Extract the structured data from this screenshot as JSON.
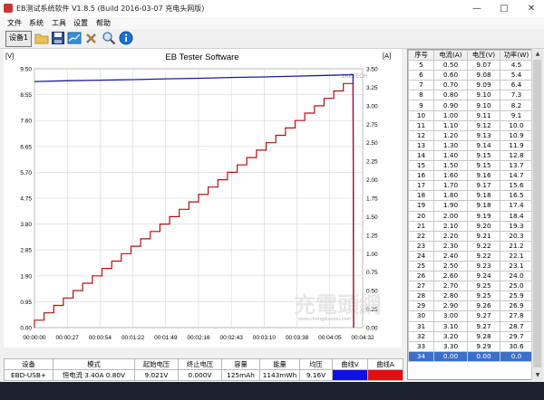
{
  "window": {
    "title": "EB测试系统软件 V1.8.5 (Build 2016-03-07 充电头网版)",
    "minimize": "—",
    "maximize": "□",
    "close": "✕"
  },
  "menu": [
    "文件",
    "系统",
    "工具",
    "设置",
    "帮助"
  ],
  "toolbar": {
    "device_button": "设备1",
    "icons": [
      "folder-icon",
      "save-icon",
      "chart-icon",
      "tools-icon",
      "search-icon",
      "info-icon"
    ]
  },
  "chart": {
    "title": "EB Tester Software",
    "left_unit": "[V]",
    "right_unit": "[A]",
    "brand_mark": "ZKETECH",
    "watermark": "充電頭網",
    "watermark_url": "www.chongdiantou.com",
    "voltage_color": "#1a1aa6",
    "current_color": "#b01010"
  },
  "chart_data": {
    "type": "line",
    "title": "EB Tester Software",
    "ylabel": "[V]",
    "y2label": "[A]",
    "xlim": [
      "00:00:00",
      "00:04:32"
    ],
    "x_tick_labels": [
      "00:00:00",
      "00:00:27",
      "00:00:54",
      "00:01:22",
      "00:01:49",
      "00:02:16",
      "00:02:43",
      "00:03:10",
      "00:03:38",
      "00:04:05",
      "00:04:32"
    ],
    "ylim": [
      0,
      9.5
    ],
    "y_tick_labels": [
      "0.00",
      "0.95",
      "1.90",
      "2.85",
      "3.80",
      "4.75",
      "5.70",
      "6.65",
      "7.60",
      "8.55",
      "9.50"
    ],
    "y2lim": [
      0,
      3.5
    ],
    "y2_tick_labels": [
      "0.00",
      "0.25",
      "0.50",
      "0.75",
      "1.00",
      "1.25",
      "1.50",
      "1.75",
      "2.00",
      "2.25",
      "2.50",
      "2.75",
      "3.00",
      "3.25",
      "3.50"
    ],
    "grid": true,
    "series": [
      {
        "axis": "left",
        "color": "#1a1aa6",
        "x_sec": [
          0,
          27,
          54,
          82,
          109,
          136,
          163,
          190,
          218,
          245,
          262,
          264,
          264.5
        ],
        "values": [
          9.03,
          9.06,
          9.08,
          9.1,
          9.13,
          9.15,
          9.18,
          9.2,
          9.23,
          9.26,
          9.28,
          9.29,
          0.0
        ]
      },
      {
        "axis": "right",
        "color": "#b01010",
        "x_sec": [
          0,
          264,
          264.5
        ],
        "values": [
          0.1,
          3.3,
          0.0
        ],
        "step_a": 0.1,
        "step_count": 33
      }
    ]
  },
  "table": {
    "headers": [
      "序号",
      "电流(A)",
      "电压(V)",
      "功率(W)"
    ],
    "rows": [
      [
        "5",
        "0.50",
        "9.07",
        "4.5"
      ],
      [
        "6",
        "0.60",
        "9.08",
        "5.4"
      ],
      [
        "7",
        "0.70",
        "9.09",
        "6.4"
      ],
      [
        "8",
        "0.80",
        "9.10",
        "7.3"
      ],
      [
        "9",
        "0.90",
        "9.10",
        "8.2"
      ],
      [
        "10",
        "1.00",
        "9.11",
        "9.1"
      ],
      [
        "11",
        "1.10",
        "9.12",
        "10.0"
      ],
      [
        "12",
        "1.20",
        "9.13",
        "10.9"
      ],
      [
        "13",
        "1.30",
        "9.14",
        "11.9"
      ],
      [
        "14",
        "1.40",
        "9.15",
        "12.8"
      ],
      [
        "15",
        "1.50",
        "9.15",
        "13.7"
      ],
      [
        "16",
        "1.60",
        "9.16",
        "14.7"
      ],
      [
        "17",
        "1.70",
        "9.17",
        "15.6"
      ],
      [
        "18",
        "1.80",
        "9.18",
        "16.5"
      ],
      [
        "19",
        "1.90",
        "9.18",
        "17.4"
      ],
      [
        "20",
        "2.00",
        "9.19",
        "18.4"
      ],
      [
        "21",
        "2.10",
        "9.20",
        "19.3"
      ],
      [
        "22",
        "2.20",
        "9.21",
        "20.3"
      ],
      [
        "23",
        "2.30",
        "9.22",
        "21.2"
      ],
      [
        "24",
        "2.40",
        "9.22",
        "22.1"
      ],
      [
        "25",
        "2.50",
        "9.23",
        "23.1"
      ],
      [
        "26",
        "2.60",
        "9.24",
        "24.0"
      ],
      [
        "27",
        "2.70",
        "9.25",
        "25.0"
      ],
      [
        "28",
        "2.80",
        "9.25",
        "25.9"
      ],
      [
        "29",
        "2.90",
        "9.26",
        "26.9"
      ],
      [
        "30",
        "3.00",
        "9.27",
        "27.8"
      ],
      [
        "31",
        "3.10",
        "9.27",
        "28.7"
      ],
      [
        "32",
        "3.20",
        "9.28",
        "29.7"
      ],
      [
        "33",
        "3.30",
        "9.29",
        "30.6"
      ],
      [
        "34",
        "0.00",
        "0.00",
        "0.0"
      ]
    ],
    "selected_row": 29
  },
  "summary": {
    "headers": [
      "设备",
      "模式",
      "起始电压",
      "终止电压",
      "容量",
      "能量",
      "均压",
      "曲线V",
      "曲线A"
    ],
    "values": [
      "EBD-USB+",
      "恒电流 3.40A 0.80V",
      "9.021V",
      "0.000V",
      "125mAh",
      "1143mWh",
      "9.16V",
      "",
      ""
    ],
    "curve_v_color": "#1010e0",
    "curve_a_color": "#e01010"
  }
}
